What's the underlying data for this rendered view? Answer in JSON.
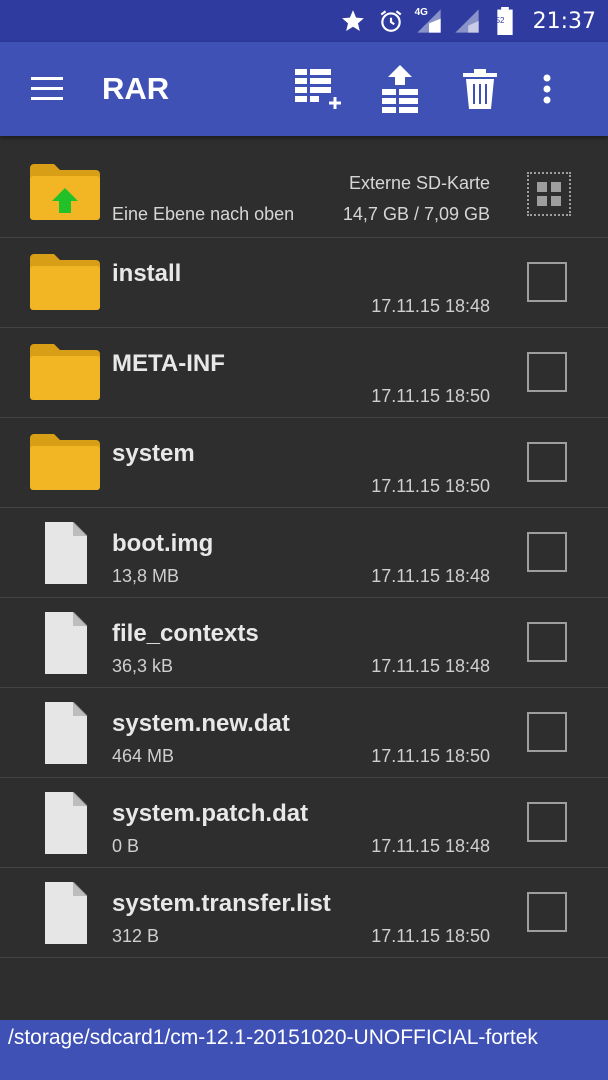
{
  "statusbar": {
    "icons": [
      "star-icon",
      "alarm-icon",
      "signal-4g-icon",
      "signal-icon",
      "battery-icon"
    ],
    "network_label": "4G",
    "battery_level": "52",
    "time": "21:37"
  },
  "appbar": {
    "title": "RAR",
    "actions": [
      "add-to-archive-icon",
      "extract-icon",
      "delete-icon",
      "more-options-icon"
    ]
  },
  "up_row": {
    "label": "Eine Ebene nach oben",
    "storage_name": "Externe SD-Karte",
    "storage_space": "14,7 GB / 7,09 GB"
  },
  "items": [
    {
      "type": "folder",
      "name": "install",
      "size": "",
      "date": "17.11.15 18:48"
    },
    {
      "type": "folder",
      "name": "META-INF",
      "size": "",
      "date": "17.11.15 18:50"
    },
    {
      "type": "folder",
      "name": "system",
      "size": "",
      "date": "17.11.15 18:50"
    },
    {
      "type": "file",
      "name": "boot.img",
      "size": "13,8 MB",
      "date": "17.11.15 18:48"
    },
    {
      "type": "file",
      "name": "file_contexts",
      "size": "36,3 kB",
      "date": "17.11.15 18:48"
    },
    {
      "type": "file",
      "name": "system.new.dat",
      "size": "464 MB",
      "date": "17.11.15 18:50"
    },
    {
      "type": "file",
      "name": "system.patch.dat",
      "size": "0 B",
      "date": "17.11.15 18:48"
    },
    {
      "type": "file",
      "name": "system.transfer.list",
      "size": "312 B",
      "date": "17.11.15 18:50"
    }
  ],
  "path": "/storage/sdcard1/cm-12.1-20151020-UNOFFICIAL-fortek",
  "colors": {
    "appbar": "#3f51b5",
    "statusbar": "#2f3b9e",
    "background": "#2e2e2e",
    "folder": "#f2b624",
    "up_arrow": "#22c12a"
  }
}
